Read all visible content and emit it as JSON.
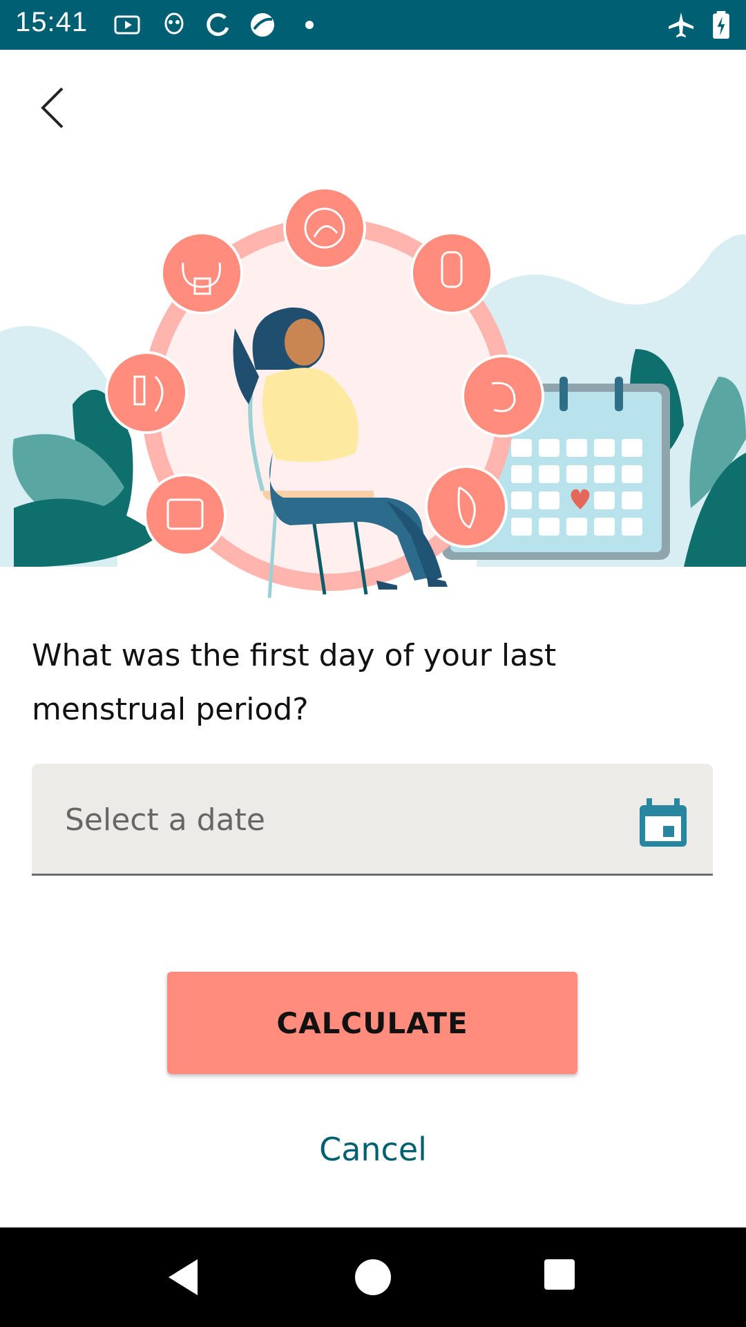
{
  "status_bar": {
    "time": "15:41",
    "icons": [
      "media-icon",
      "alien-icon",
      "sync-icon",
      "browser-icon",
      "dot-icon",
      "airplane-icon",
      "battery-charging-icon"
    ]
  },
  "header": {
    "back_icon": "chevron-left-icon"
  },
  "form": {
    "question": "What was the first day of your last menstrual period?",
    "date_placeholder": "Select a date",
    "calendar_icon": "calendar-icon",
    "calculate_label": "CALCULATE",
    "cancel_label": "Cancel"
  },
  "colors": {
    "status_bar": "#005f73",
    "accent": "#ff8c7c",
    "link": "#00606f",
    "field_bg": "#ecebe8"
  },
  "nav_bar": {
    "icons": [
      "back-triangle-icon",
      "home-circle-icon",
      "recents-square-icon"
    ]
  }
}
